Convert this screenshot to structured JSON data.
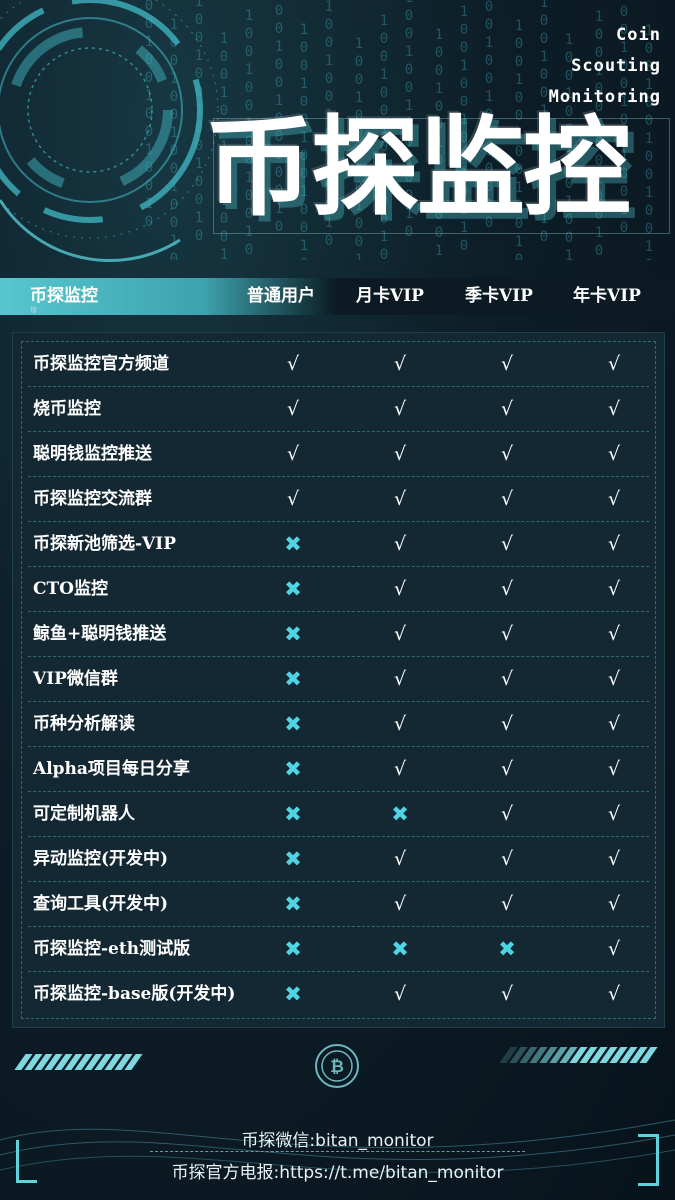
{
  "brand": {
    "tagline": [
      "Coin",
      "Scouting",
      "Monitoring"
    ],
    "title": "币探监控"
  },
  "header": {
    "feature_col": "币探监控",
    "sub_mark": "增",
    "tiers": [
      "普通用户",
      "月卡VIP",
      "季卡VIP",
      "年卡VIP"
    ]
  },
  "features": [
    {
      "name": "币探监控官方频道",
      "values": [
        "√",
        "√",
        "√",
        "√"
      ]
    },
    {
      "name": "烧币监控",
      "values": [
        "√",
        "√",
        "√",
        "√"
      ]
    },
    {
      "name": "聪明钱监控推送",
      "values": [
        "√",
        "√",
        "√",
        "√"
      ]
    },
    {
      "name": "币探监控交流群",
      "values": [
        "√",
        "√",
        "√",
        "√"
      ]
    },
    {
      "name": "币探新池筛选-VIP",
      "values": [
        "✖",
        "√",
        "√",
        "√"
      ]
    },
    {
      "name": "CTO监控",
      "values": [
        "✖",
        "√",
        "√",
        "√"
      ]
    },
    {
      "name": "鲸鱼+聪明钱推送",
      "values": [
        "✖",
        "√",
        "√",
        "√"
      ]
    },
    {
      "name": "VIP微信群",
      "values": [
        "✖",
        "√",
        "√",
        "√"
      ]
    },
    {
      "name": "币种分析解读",
      "values": [
        "✖",
        "√",
        "√",
        "√"
      ]
    },
    {
      "name": "Alpha项目每日分享",
      "values": [
        "✖",
        "√",
        "√",
        "√"
      ]
    },
    {
      "name": "可定制机器人",
      "values": [
        "✖",
        "✖",
        "√",
        "√"
      ]
    },
    {
      "name": "异动监控(开发中)",
      "values": [
        "✖",
        "√",
        "√",
        "√"
      ]
    },
    {
      "name": "查询工具(开发中)",
      "values": [
        "✖",
        "√",
        "√",
        "√"
      ]
    },
    {
      "name": "币探监控-eth测试版",
      "values": [
        "✖",
        "✖",
        "✖",
        "√"
      ]
    },
    {
      "name": "币探监控-base版(开发中)",
      "values": [
        "✖",
        "√",
        "√",
        "√"
      ]
    }
  ],
  "footer": {
    "wechat": "币探微信:bitan_monitor",
    "telegram": "币探官方电报:https://t.me/bitan_monitor"
  },
  "colors": {
    "accent": "#56c7cf",
    "cross": "#4fd4e4",
    "panel": "#142833"
  },
  "icons": {
    "coin": "bitcoin-icon"
  }
}
